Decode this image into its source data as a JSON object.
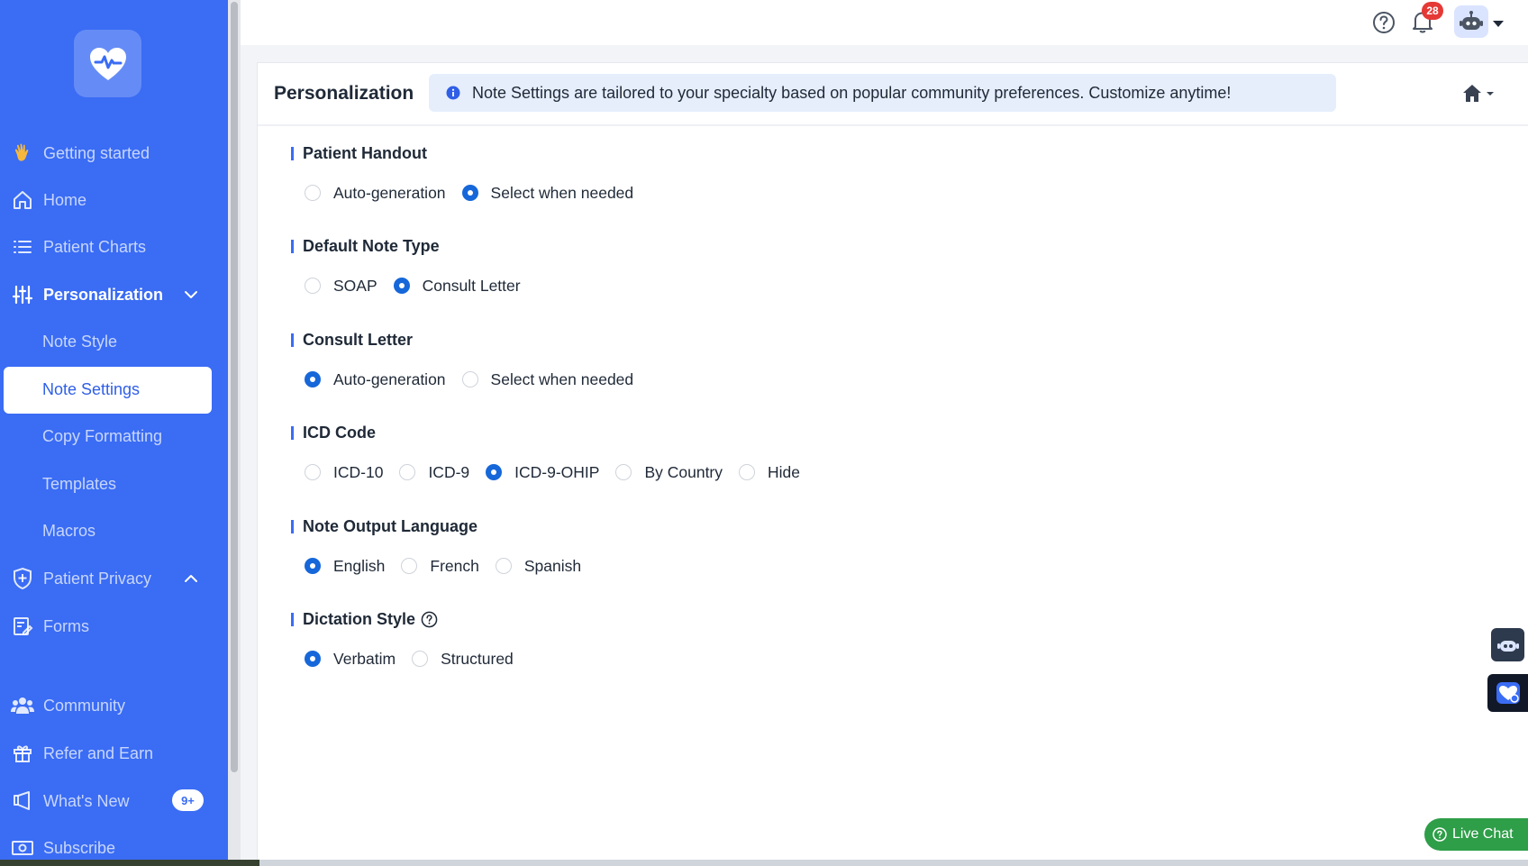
{
  "sidebar": {
    "items": [
      {
        "label": "Getting started",
        "icon": "waving-hand-icon"
      },
      {
        "label": "Home",
        "icon": "home-icon"
      },
      {
        "label": "Patient Charts",
        "icon": "list-icon"
      },
      {
        "label": "Personalization",
        "icon": "sliders-icon"
      },
      {
        "label": "Patient Privacy",
        "icon": "shield-plus-icon"
      },
      {
        "label": "Forms",
        "icon": "form-edit-icon"
      },
      {
        "label": "Community",
        "icon": "users-icon"
      },
      {
        "label": "Refer and Earn",
        "icon": "gift-icon"
      },
      {
        "label": "What's New",
        "icon": "megaphone-icon",
        "badge": "9+"
      },
      {
        "label": "Subscribe",
        "icon": "money-icon"
      }
    ],
    "personalization_sub": [
      {
        "label": "Note Style"
      },
      {
        "label": "Note Settings",
        "selected": true
      },
      {
        "label": "Copy Formatting"
      },
      {
        "label": "Templates"
      },
      {
        "label": "Macros"
      }
    ]
  },
  "topbar": {
    "notification_count": "28"
  },
  "header": {
    "title": "Personalization",
    "banner": "Note Settings are tailored to your specialty based on popular community preferences. Customize anytime!"
  },
  "sections": [
    {
      "title": "Patient Handout",
      "options": [
        "Auto-generation",
        "Select when needed"
      ],
      "selected": 1
    },
    {
      "title": "Default Note Type",
      "options": [
        "SOAP",
        "Consult Letter"
      ],
      "selected": 1
    },
    {
      "title": "Consult Letter",
      "options": [
        "Auto-generation",
        "Select when needed"
      ],
      "selected": 0
    },
    {
      "title": "ICD Code",
      "options": [
        "ICD-10",
        "ICD-9",
        "ICD-9-OHIP",
        "By Country",
        "Hide"
      ],
      "selected": 2
    },
    {
      "title": "Note Output Language",
      "options": [
        "English",
        "French",
        "Spanish"
      ],
      "selected": 0
    },
    {
      "title": "Dictation Style",
      "options": [
        "Verbatim",
        "Structured"
      ],
      "selected": 0,
      "help": true
    }
  ],
  "live_chat": {
    "label": "Live Chat"
  },
  "colors": {
    "sidebar": "#3a6cf4",
    "radio_checked": "#1667d9",
    "banner_bg": "#e6eefc",
    "live_chat": "#2e9e48",
    "badge_red": "#e53935"
  }
}
